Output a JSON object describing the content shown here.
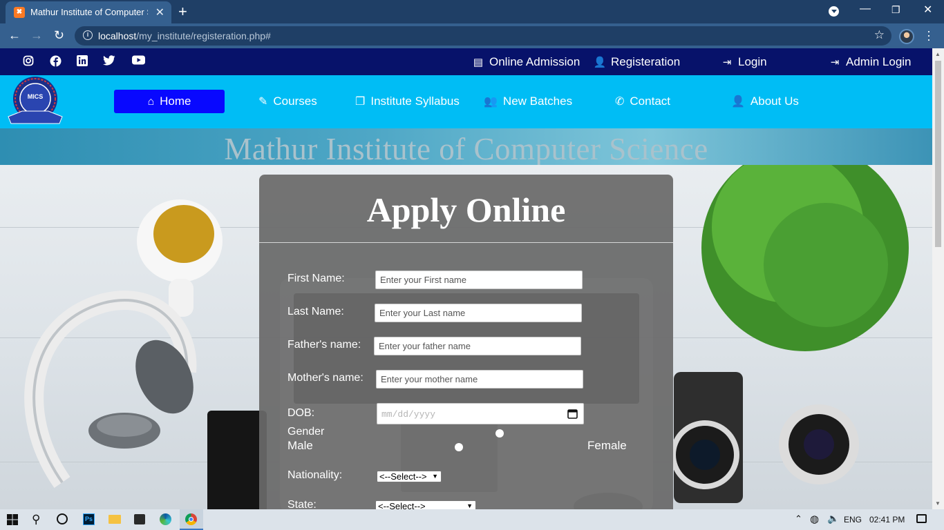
{
  "browser": {
    "tab_title": "Mathur Institute of Computer Science",
    "tab_close": "✕",
    "new_tab": "+",
    "url_host": "localhost",
    "url_path": "/my_institute/registeration.php#"
  },
  "topbar": {
    "links": [
      {
        "label": "Online Admission",
        "icon": "document-icon"
      },
      {
        "label": "Registeration",
        "icon": "user-plus-icon"
      },
      {
        "label": "Login",
        "icon": "sign-in-icon"
      },
      {
        "label": "Admin Login",
        "icon": "sign-in-icon"
      }
    ],
    "socials": [
      "instagram-icon",
      "facebook-icon",
      "linkedin-icon",
      "twitter-icon",
      "youtube-icon"
    ]
  },
  "nav": {
    "logo_text": "MICS",
    "items": [
      {
        "label": "Home",
        "icon": "home-icon",
        "active": true
      },
      {
        "label": "Courses",
        "icon": "edit-icon"
      },
      {
        "label": "Institute Syllabus",
        "icon": "copy-icon"
      },
      {
        "label": "New Batches",
        "icon": "users-icon"
      },
      {
        "label": "Contact",
        "icon": "phone-icon"
      },
      {
        "label": "About Us",
        "icon": "user-icon"
      }
    ]
  },
  "banner": {
    "title": "Mathur Institute of Computer Science"
  },
  "form": {
    "title": "Apply Online",
    "fields": {
      "first_name": {
        "label": "First Name:",
        "placeholder": "Enter your First name"
      },
      "last_name": {
        "label": "Last Name:",
        "placeholder": "Enter your Last name"
      },
      "father_name": {
        "label": "Father's name:",
        "placeholder": "Enter your father name"
      },
      "mother_name": {
        "label": "Mother's name:",
        "placeholder": "Enter your mother name"
      },
      "dob": {
        "label": "DOB:",
        "placeholder": "mm/dd/yyyy"
      },
      "gender": {
        "label": "Gender",
        "male": "Male",
        "female": "Female"
      },
      "nationality": {
        "label": "Nationality:",
        "selected": "<--Select-->"
      },
      "state": {
        "label": "State:",
        "selected": "<--Select-->"
      }
    }
  },
  "taskbar": {
    "language": "ENG",
    "time": "02:41 PM"
  },
  "colors": {
    "top_strip": "#07126a",
    "nav_bar": "#00bdf5",
    "home_active": "#0808ff",
    "form_panel": "#696969"
  }
}
